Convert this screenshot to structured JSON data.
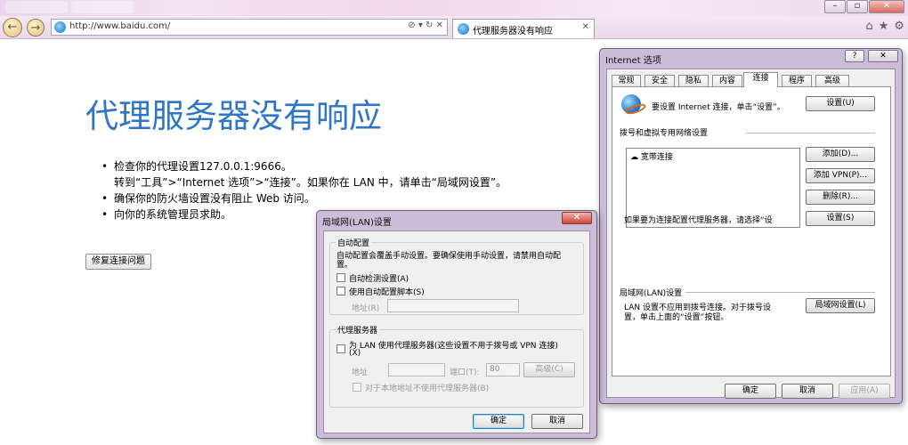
{
  "browser": {
    "address": "http://www.baidu.com/",
    "tab_title": "代理服务器没有响应",
    "tab_close": "✕",
    "addr_tools": "⊘ ▾ ↻ ✕",
    "icons": [
      "home-icon",
      "star-icon",
      "gear-icon"
    ]
  },
  "page": {
    "title": "代理服务器没有响应",
    "bullets": [
      {
        "line1": "检查你的代理设置127.0.0.1:9666。",
        "line2": "转到“工具”>“Internet 选项”>“连接”。如果你在 LAN 中，请单击“局域网设置”。"
      },
      {
        "line1": "确保你的防火墙设置没有阻止 Web 访问。"
      },
      {
        "line1": "向你的系统管理员求助。"
      }
    ],
    "fix_button": "修复连接问题"
  },
  "internet_options": {
    "title": "Internet 选项",
    "help": "?",
    "close": "✕",
    "tabs": [
      "常规",
      "安全",
      "隐私",
      "内容",
      "连接",
      "程序",
      "高级"
    ],
    "active_tab": "连接",
    "setup_text": "要设置 Internet 连接，单击“设置”。",
    "setup_button": "设置(U)",
    "dialup_header": "拨号和虚拟专用网络设置",
    "connections": [
      "宽带连接"
    ],
    "add_button": "添加(D)...",
    "add_vpn_button": "添加 VPN(P)...",
    "remove_button": "删除(R)...",
    "proxy_text": "如果要为连接配置代理服务器，请选择“设",
    "settings_button": "设置(S)",
    "lan_header": "局域网(LAN)设置",
    "lan_text_1": "LAN 设置不应用到拨号连接。对于拨号设",
    "lan_text_2": "置，单击上面的“设置”按钮。",
    "lan_settings_button": "局域网设置(L)",
    "ok": "确定",
    "cancel": "取消",
    "apply": "应用(A)"
  },
  "lan_dialog": {
    "title": "局域网(LAN)设置",
    "close": "✕",
    "auto_config_header": "自动配置",
    "auto_config_text_1": "自动配置会覆盖手动设置。要确保使用手动设置，请禁用自动配",
    "auto_config_text_2": "置。",
    "auto_detect": "自动检测设置(A)",
    "use_script": "使用自动配置脚本(S)",
    "address_label": "地址(R)",
    "proxy_header": "代理服务器",
    "use_proxy_1": "为 LAN 使用代理服务器(这些设置不用于拨号或 VPN 连接)",
    "use_proxy_2": "(X)",
    "proxy_address_label": "地址",
    "port_label": "端口(T):",
    "port_value": "80",
    "advanced_button": "高级(C)",
    "bypass_local": "对于本地地址不使用代理服务器(B)",
    "ok": "确定",
    "cancel": "取消"
  }
}
